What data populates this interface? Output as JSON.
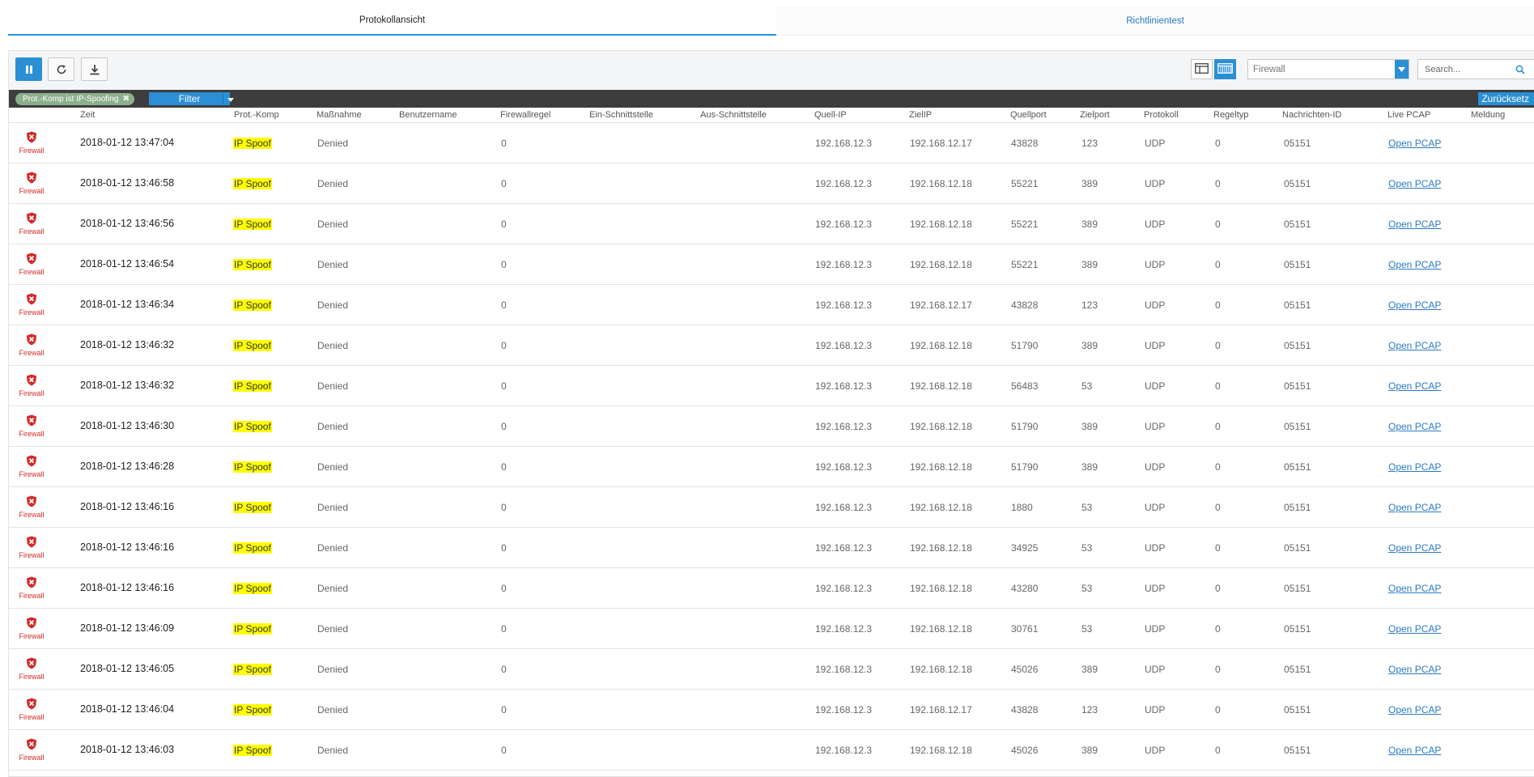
{
  "tabs": [
    {
      "label": "Protokollansicht",
      "active": true
    },
    {
      "label": "Richtlinientest",
      "active": false
    }
  ],
  "toolbar": {
    "pause_icon": "pause-icon",
    "refresh_icon": "refresh-icon",
    "download_icon": "download-icon",
    "source_select": {
      "value": "Firewall",
      "placeholder": "Firewall"
    },
    "search": {
      "placeholder": "Search...",
      "value": ""
    }
  },
  "filterbar": {
    "chip_label": "Prot.-Komp ist IP-Spoofing",
    "filter_button": "Filter",
    "reset_button": "Zurücksetz"
  },
  "colors": {
    "accent": "#2b8fd6",
    "highlight": "#ffff00",
    "danger": "#d32a2a",
    "filterbar": "#3d3d3d",
    "chip": "#8cb08c"
  },
  "table": {
    "columns": [
      "Zeit",
      "Prot.-Komp",
      "Maßnahme",
      "Benutzername",
      "Firewallregel",
      "Ein-Schnittstelle",
      "Aus-Schnittstelle",
      "Quell-IP",
      "ZielIP",
      "Quellport",
      "Zielport",
      "Protokoll",
      "Regeltyp",
      "Nachrichten-ID",
      "Live PCAP",
      "Meldung"
    ],
    "type_label": "Firewall",
    "rows": [
      {
        "time": "2018-01-12 13:47:04",
        "comp": "IP Spoof",
        "action": "Denied",
        "user": "",
        "rule": "0",
        "in": "",
        "out": "",
        "src": "192.168.12.3",
        "dst": "192.168.12.17",
        "sport": "43828",
        "dport": "123",
        "proto": "UDP",
        "ruletype": "0",
        "msgid": "05151",
        "pcap": "Open PCAP",
        "msg": ""
      },
      {
        "time": "2018-01-12 13:46:58",
        "comp": "IP Spoof",
        "action": "Denied",
        "user": "",
        "rule": "0",
        "in": "",
        "out": "",
        "src": "192.168.12.3",
        "dst": "192.168.12.18",
        "sport": "55221",
        "dport": "389",
        "proto": "UDP",
        "ruletype": "0",
        "msgid": "05151",
        "pcap": "Open PCAP",
        "msg": ""
      },
      {
        "time": "2018-01-12 13:46:56",
        "comp": "IP Spoof",
        "action": "Denied",
        "user": "",
        "rule": "0",
        "in": "",
        "out": "",
        "src": "192.168.12.3",
        "dst": "192.168.12.18",
        "sport": "55221",
        "dport": "389",
        "proto": "UDP",
        "ruletype": "0",
        "msgid": "05151",
        "pcap": "Open PCAP",
        "msg": ""
      },
      {
        "time": "2018-01-12 13:46:54",
        "comp": "IP Spoof",
        "action": "Denied",
        "user": "",
        "rule": "0",
        "in": "",
        "out": "",
        "src": "192.168.12.3",
        "dst": "192.168.12.18",
        "sport": "55221",
        "dport": "389",
        "proto": "UDP",
        "ruletype": "0",
        "msgid": "05151",
        "pcap": "Open PCAP",
        "msg": ""
      },
      {
        "time": "2018-01-12 13:46:34",
        "comp": "IP Spoof",
        "action": "Denied",
        "user": "",
        "rule": "0",
        "in": "",
        "out": "",
        "src": "192.168.12.3",
        "dst": "192.168.12.17",
        "sport": "43828",
        "dport": "123",
        "proto": "UDP",
        "ruletype": "0",
        "msgid": "05151",
        "pcap": "Open PCAP",
        "msg": ""
      },
      {
        "time": "2018-01-12 13:46:32",
        "comp": "IP Spoof",
        "action": "Denied",
        "user": "",
        "rule": "0",
        "in": "",
        "out": "",
        "src": "192.168.12.3",
        "dst": "192.168.12.18",
        "sport": "51790",
        "dport": "389",
        "proto": "UDP",
        "ruletype": "0",
        "msgid": "05151",
        "pcap": "Open PCAP",
        "msg": ""
      },
      {
        "time": "2018-01-12 13:46:32",
        "comp": "IP Spoof",
        "action": "Denied",
        "user": "",
        "rule": "0",
        "in": "",
        "out": "",
        "src": "192.168.12.3",
        "dst": "192.168.12.18",
        "sport": "56483",
        "dport": "53",
        "proto": "UDP",
        "ruletype": "0",
        "msgid": "05151",
        "pcap": "Open PCAP",
        "msg": ""
      },
      {
        "time": "2018-01-12 13:46:30",
        "comp": "IP Spoof",
        "action": "Denied",
        "user": "",
        "rule": "0",
        "in": "",
        "out": "",
        "src": "192.168.12.3",
        "dst": "192.168.12.18",
        "sport": "51790",
        "dport": "389",
        "proto": "UDP",
        "ruletype": "0",
        "msgid": "05151",
        "pcap": "Open PCAP",
        "msg": ""
      },
      {
        "time": "2018-01-12 13:46:28",
        "comp": "IP Spoof",
        "action": "Denied",
        "user": "",
        "rule": "0",
        "in": "",
        "out": "",
        "src": "192.168.12.3",
        "dst": "192.168.12.18",
        "sport": "51790",
        "dport": "389",
        "proto": "UDP",
        "ruletype": "0",
        "msgid": "05151",
        "pcap": "Open PCAP",
        "msg": ""
      },
      {
        "time": "2018-01-12 13:46:16",
        "comp": "IP Spoof",
        "action": "Denied",
        "user": "",
        "rule": "0",
        "in": "",
        "out": "",
        "src": "192.168.12.3",
        "dst": "192.168.12.18",
        "sport": "1880",
        "dport": "53",
        "proto": "UDP",
        "ruletype": "0",
        "msgid": "05151",
        "pcap": "Open PCAP",
        "msg": ""
      },
      {
        "time": "2018-01-12 13:46:16",
        "comp": "IP Spoof",
        "action": "Denied",
        "user": "",
        "rule": "0",
        "in": "",
        "out": "",
        "src": "192.168.12.3",
        "dst": "192.168.12.18",
        "sport": "34925",
        "dport": "53",
        "proto": "UDP",
        "ruletype": "0",
        "msgid": "05151",
        "pcap": "Open PCAP",
        "msg": ""
      },
      {
        "time": "2018-01-12 13:46:16",
        "comp": "IP Spoof",
        "action": "Denied",
        "user": "",
        "rule": "0",
        "in": "",
        "out": "",
        "src": "192.168.12.3",
        "dst": "192.168.12.18",
        "sport": "43280",
        "dport": "53",
        "proto": "UDP",
        "ruletype": "0",
        "msgid": "05151",
        "pcap": "Open PCAP",
        "msg": ""
      },
      {
        "time": "2018-01-12 13:46:09",
        "comp": "IP Spoof",
        "action": "Denied",
        "user": "",
        "rule": "0",
        "in": "",
        "out": "",
        "src": "192.168.12.3",
        "dst": "192.168.12.18",
        "sport": "30761",
        "dport": "53",
        "proto": "UDP",
        "ruletype": "0",
        "msgid": "05151",
        "pcap": "Open PCAP",
        "msg": ""
      },
      {
        "time": "2018-01-12 13:46:05",
        "comp": "IP Spoof",
        "action": "Denied",
        "user": "",
        "rule": "0",
        "in": "",
        "out": "",
        "src": "192.168.12.3",
        "dst": "192.168.12.18",
        "sport": "45026",
        "dport": "389",
        "proto": "UDP",
        "ruletype": "0",
        "msgid": "05151",
        "pcap": "Open PCAP",
        "msg": ""
      },
      {
        "time": "2018-01-12 13:46:04",
        "comp": "IP Spoof",
        "action": "Denied",
        "user": "",
        "rule": "0",
        "in": "",
        "out": "",
        "src": "192.168.12.3",
        "dst": "192.168.12.17",
        "sport": "43828",
        "dport": "123",
        "proto": "UDP",
        "ruletype": "0",
        "msgid": "05151",
        "pcap": "Open PCAP",
        "msg": ""
      },
      {
        "time": "2018-01-12 13:46:03",
        "comp": "IP Spoof",
        "action": "Denied",
        "user": "",
        "rule": "0",
        "in": "",
        "out": "",
        "src": "192.168.12.3",
        "dst": "192.168.12.18",
        "sport": "45026",
        "dport": "389",
        "proto": "UDP",
        "ruletype": "0",
        "msgid": "05151",
        "pcap": "Open PCAP",
        "msg": ""
      }
    ]
  }
}
